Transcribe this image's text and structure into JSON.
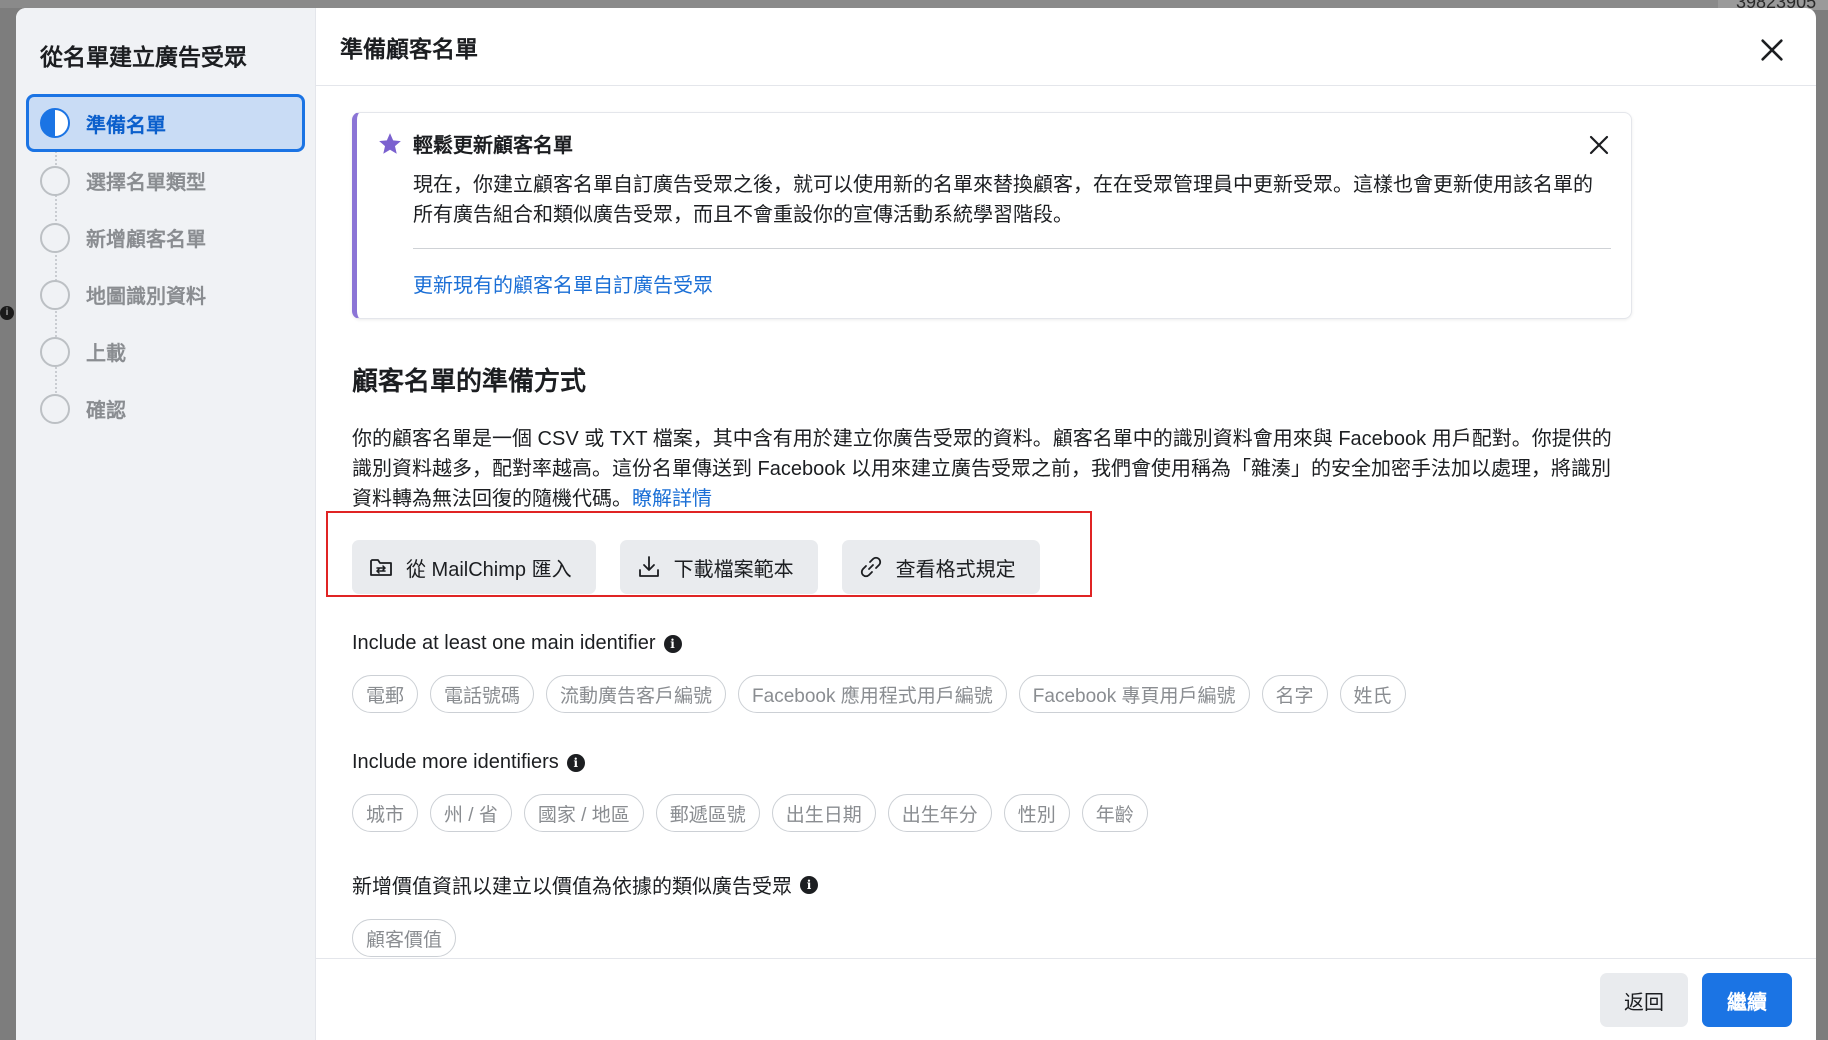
{
  "background": {
    "number_fragment": "39823905"
  },
  "sidebar": {
    "title": "從名單建立廣告受眾",
    "steps": [
      {
        "label": "準備名單",
        "active": true
      },
      {
        "label": "選擇名單類型",
        "active": false
      },
      {
        "label": "新增顧客名單",
        "active": false
      },
      {
        "label": "地圖識別資料",
        "active": false
      },
      {
        "label": "上載",
        "active": false
      },
      {
        "label": "確認",
        "active": false
      }
    ]
  },
  "header": {
    "title": "準備顧客名單"
  },
  "notice": {
    "title": "輕鬆更新顧客名單",
    "body": "現在，你建立顧客名單自訂廣告受眾之後，就可以使用新的名單來替換顧客，在在受眾管理員中更新受眾。這樣也會更新使用該名單的所有廣告組合和類似廣告受眾，而且不會重設你的宣傳活動系統學習階段。",
    "link": "更新現有的顧客名單自訂廣告受眾"
  },
  "section": {
    "title": "顧客名單的準備方式",
    "description": "你的顧客名單是一個 CSV 或 TXT 檔案，其中含有用於建立你廣告受眾的資料。顧客名單中的識別資料會用來與 Facebook 用戶配對。你提供的識別資料越多，配對率越高。這份名單傳送到 Facebook 以用來建立廣告受眾之前，我們會使用稱為「雜湊」的安全加密手法加以處理，將識別資料轉為無法回復的隨機代碼。",
    "learn_more": "瞭解詳情"
  },
  "buttons": {
    "mailchimp": "從 MailChimp 匯入",
    "download": "下載檔案範本",
    "format": "查看格式規定"
  },
  "main_identifiers": {
    "title": "Include at least one main identifier",
    "tags": [
      "電郵",
      "電話號碼",
      "流動廣告客戶編號",
      "Facebook 應用程式用戶編號",
      "Facebook 專頁用戶編號",
      "名字",
      "姓氏"
    ]
  },
  "more_identifiers": {
    "title": "Include more identifiers",
    "tags": [
      "城市",
      "州 / 省",
      "國家 / 地區",
      "郵遞區號",
      "出生日期",
      "出生年分",
      "性別",
      "年齡"
    ]
  },
  "value_info": {
    "title": "新增價值資訊以建立以價值為依據的類似廣告受眾",
    "tags": [
      "顧客價值"
    ]
  },
  "footer": {
    "back": "返回",
    "next": "繼續"
  },
  "colors": {
    "accent": "#1b74e4",
    "notice_border": "#8b74d6",
    "highlight": "#e02424"
  }
}
